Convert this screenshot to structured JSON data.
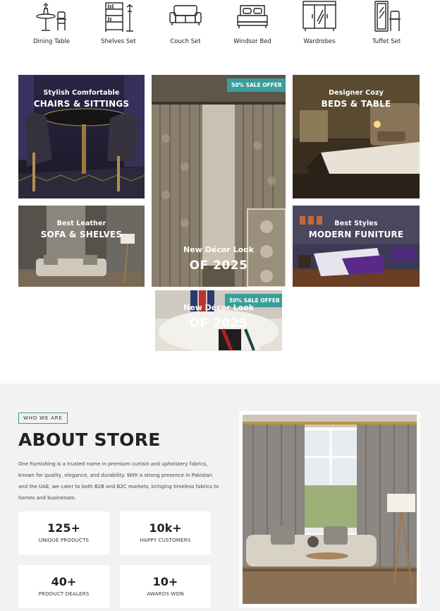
{
  "categories": [
    {
      "label": "Dining Table",
      "icon": "dining-table-icon"
    },
    {
      "label": "Shelves Set",
      "icon": "shelves-icon"
    },
    {
      "label": "Couch Set",
      "icon": "couch-icon"
    },
    {
      "label": "Windsor Bed",
      "icon": "bed-icon"
    },
    {
      "label": "Wardrobes",
      "icon": "wardrobe-icon"
    },
    {
      "label": "Tuffet Set",
      "icon": "tuffet-icon"
    }
  ],
  "promos": {
    "chairs": {
      "small": "Stylish Comfortable",
      "big": "CHAIRS & SITTINGS"
    },
    "beds": {
      "small": "Designer Cozy",
      "big": "BEDS & TABLE"
    },
    "sofa": {
      "small": "Best Leather",
      "big": "SOFA & SHELVES"
    },
    "modern": {
      "small": "Best Styles",
      "big": "MODERN FUNITURE"
    },
    "curtain": {
      "sale": "50% SALE OFFER",
      "line1": "New Décor Look",
      "line2": "OF 2025"
    },
    "cushion": {
      "sale": "50% SALE OFFER",
      "line1": "New Décor Look",
      "line2": "OF 2025"
    }
  },
  "about": {
    "tag": "WHO WE ARE",
    "title": "ABOUT STORE",
    "text": "One Furnishing is a trusted name in premium curtain and upholstery fabrics, known for quality, elegance, and durability. With a strong presence in Pakistan and the UAE, we cater to both B2B and B2C markets, bringing timeless fabrics to homes and businesses.",
    "stats": [
      {
        "value": "125+",
        "label": "UNIQUE PRODUCTS"
      },
      {
        "value": "10k+",
        "label": "HAPPY CUSTOMERS"
      },
      {
        "value": "40+",
        "label": "PRODUCT DEALERS"
      },
      {
        "value": "10+",
        "label": "AWARDS WON"
      }
    ]
  },
  "colors": {
    "accent": "#3a9e9a",
    "section_bg": "#f2f2f2"
  }
}
